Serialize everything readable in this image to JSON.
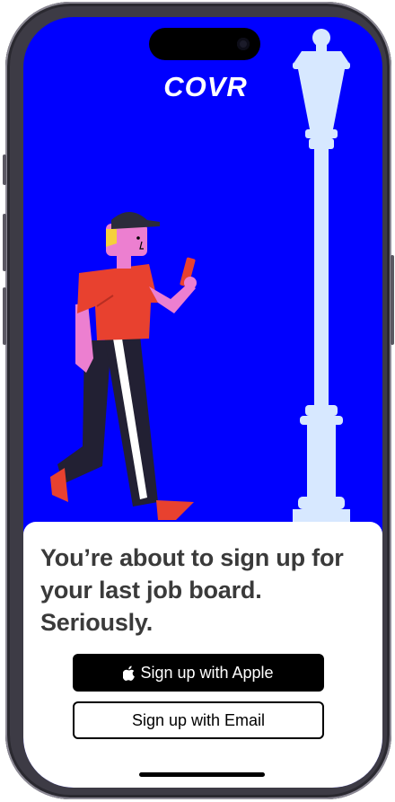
{
  "app": {
    "logo_text": "COVR"
  },
  "onboarding": {
    "headline": "You’re about to sign up for your last job board. Seriously.",
    "apple_button_label": "Sign up with Apple",
    "email_button_label": "Sign up with Email"
  },
  "colors": {
    "background_blue": "#0000ff",
    "lamp": "#d7e8ff",
    "shirt": "#e8412f",
    "skin": "#ec7fd0",
    "button_black": "#000000"
  },
  "icons": [
    "apple-icon"
  ]
}
